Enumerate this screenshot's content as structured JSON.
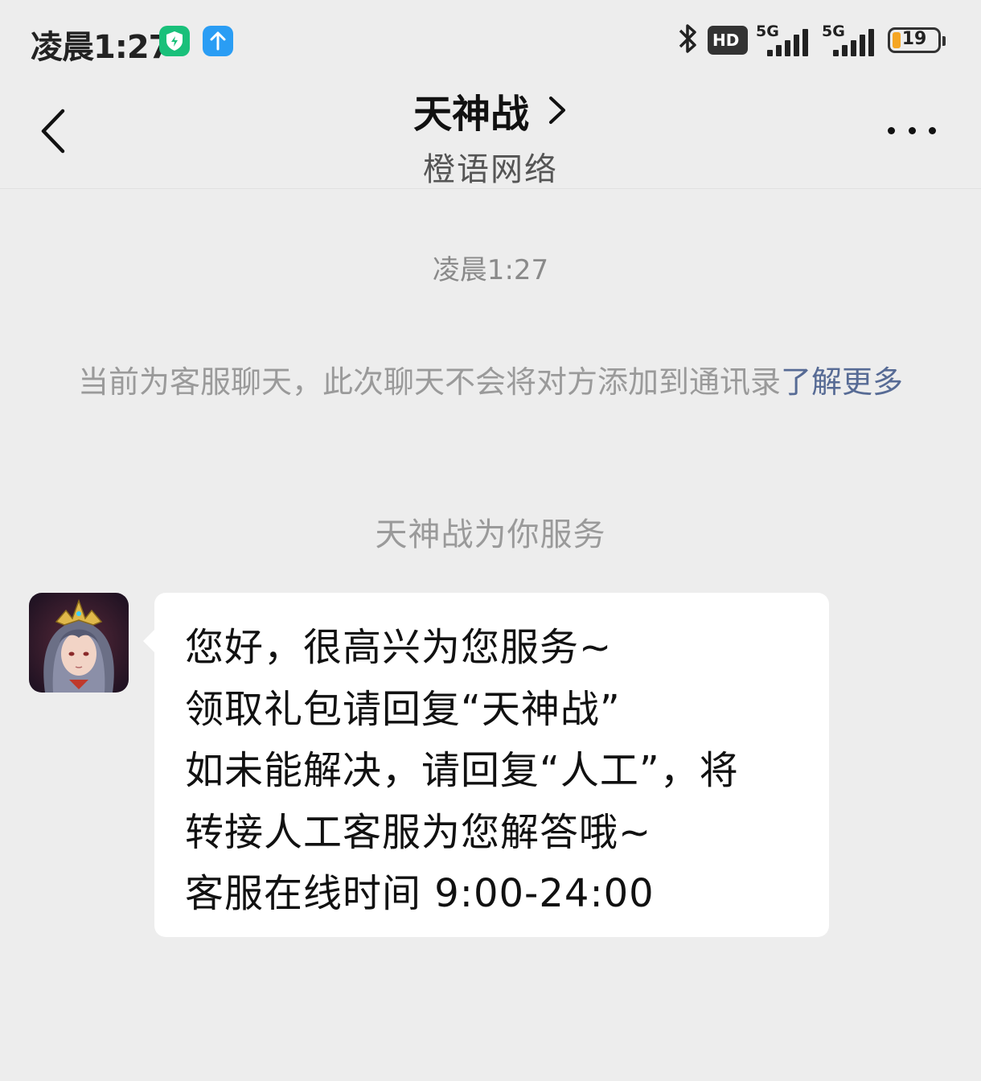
{
  "status_bar": {
    "time": "凌晨1:27",
    "hd_label": "HD",
    "sim1_network": "5G",
    "sim2_network": "5G",
    "battery_level": "19",
    "battery_fraction": 0.19,
    "icons": [
      "shield-app-icon",
      "upload-app-icon",
      "bluetooth-icon",
      "hd-voice-icon",
      "signal-icon",
      "signal-icon",
      "battery-icon"
    ]
  },
  "header": {
    "title": "天神战",
    "subtitle": "橙语网络",
    "icons": [
      "back-arrow-icon",
      "chevron-right-icon",
      "more-icon"
    ]
  },
  "chat": {
    "timestamp": "凌晨1:27",
    "notice_text": "当前为客服聊天，此次聊天不会将对方添加到通讯录",
    "notice_link": "了解更多",
    "service_text": "天神战为你服务",
    "message": {
      "lines": [
        "您好，很高兴为您服务~",
        "领取礼包请回复“天神战”",
        "如未能解决，请回复“人工”，将",
        "转接人工客服为您解答哦~",
        "客服在线时间 9:00-24:00"
      ]
    }
  }
}
